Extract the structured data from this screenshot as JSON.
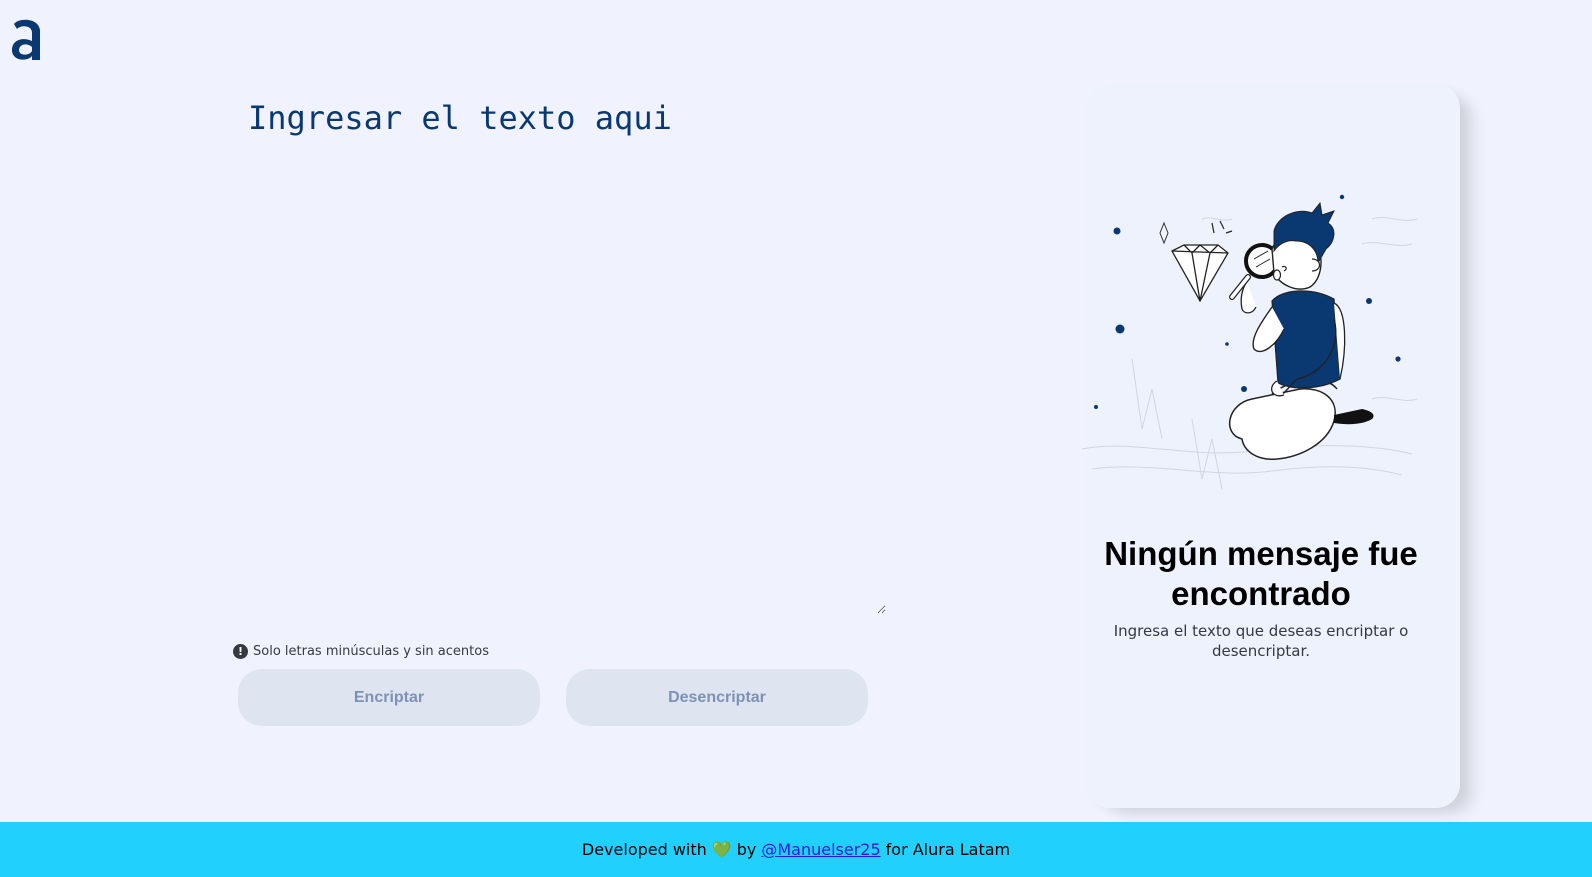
{
  "logo": {
    "icon": "alura-logo-icon",
    "color": "#0a3871"
  },
  "editor": {
    "placeholder": "Ingresar el texto aqui",
    "value": ""
  },
  "hint": {
    "icon": "exclamation-circle-icon",
    "text": "Solo letras minúsculas y sin acentos"
  },
  "buttons": {
    "encrypt": "Encriptar",
    "decrypt": "Desencriptar"
  },
  "output": {
    "illustration": "person-with-magnifying-glass-illustration",
    "title": "Ningún mensaje fue encontrado",
    "text": "Ingresa el texto que deseas encriptar o desencriptar."
  },
  "footer": {
    "prefix": "Developed with",
    "heart": "💚",
    "by": "by",
    "link": "@Manuelser25",
    "suffix": "for Alura Latam"
  },
  "colors": {
    "primary": "#0a3871",
    "background": "#f0f3fd",
    "footer": "#21d0fd",
    "button_bg": "#dfe4f1"
  }
}
